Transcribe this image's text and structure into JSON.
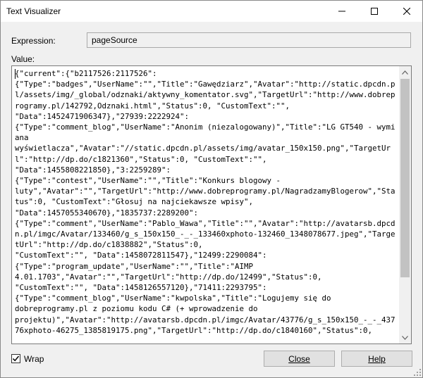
{
  "window": {
    "title": "Text Visualizer"
  },
  "expression": {
    "label": "Expression:",
    "value": "pageSource"
  },
  "value": {
    "label": "Value:",
    "text": "{\"current\":{\"b2117526:2117526\":\n{\"Type\":\"badges\",\"UserName\":\"\",\"Title\":\"Gawędziarz\",\"Avatar\":\"http://static.dpcdn.pl/assets/img/_global/odznaki/aktywny_komentator.svg\",\"TargetUrl\":\"http://www.dobreprogramy.pl/142792,Odznaki.html\",\"Status\":0, \"CustomText\":\"\",\n\"Data\":1452471906347},\"27939:2222924\":\n{\"Type\":\"comment_blog\",\"UserName\":\"Anonim (niezalogowany)\",\"Title\":\"LG GT540 - wymiana\nwyświetlacza\",\"Avatar\":\"//static.dpcdn.pl/assets/img/avatar_150x150.png\",\"TargetUrl\":\"http://dp.do/c1821360\",\"Status\":0, \"CustomText\":\"\",\n\"Data\":1455808221850},\"3:2259289\":\n{\"Type\":\"contest\",\"UserName\":\"\",\"Title\":\"Konkurs blogowy -\nluty\",\"Avatar\":\"\",\"TargetUrl\":\"http://www.dobreprogramy.pl/NagradzamyBlogerow\",\"Status\":0, \"CustomText\":\"Głosuj na najciekawsze wpisy\",\n\"Data\":1457055340670},\"1835737:2289200\":\n{\"Type\":\"comment\",\"UserName\":\"Pablo_Wawa\",\"Title\":\"\",\"Avatar\":\"http://avatarsb.dpcdn.pl/imgc/Avatar/133460/g_s_150x150_-_-_133460xphoto-132460_1348078677.jpeg\",\"TargetUrl\":\"http://dp.do/c1838882\",\"Status\":0,\n\"CustomText\":\"\", \"Data\":1458072811547},\"12499:2290084\":\n{\"Type\":\"program_update\",\"UserName\":\"\",\"Title\":\"AIMP\n4.01.1703\",\"Avatar\":\"\",\"TargetUrl\":\"http://dp.do/12499\",\"Status\":0,\n\"CustomText\":\"\", \"Data\":1458126557120},\"71411:2293795\":\n{\"Type\":\"comment_blog\",\"UserName\":\"kwpolska\",\"Title\":\"Logujemy się do\ndobreprogramy.pl z poziomu kodu C# (+ wprowadzenie do\nprojektu)\",\"Avatar\":\"http://avatarsb.dpcdn.pl/imgc/Avatar/43776/g_s_150x150_-_-_43776xphoto-46275_1385819175.png\",\"TargetUrl\":\"http://dp.do/c1840160\",\"Status\":0,"
  },
  "wrap": {
    "label": "Wrap",
    "checked": true
  },
  "buttons": {
    "close": "Close",
    "help": "Help"
  }
}
